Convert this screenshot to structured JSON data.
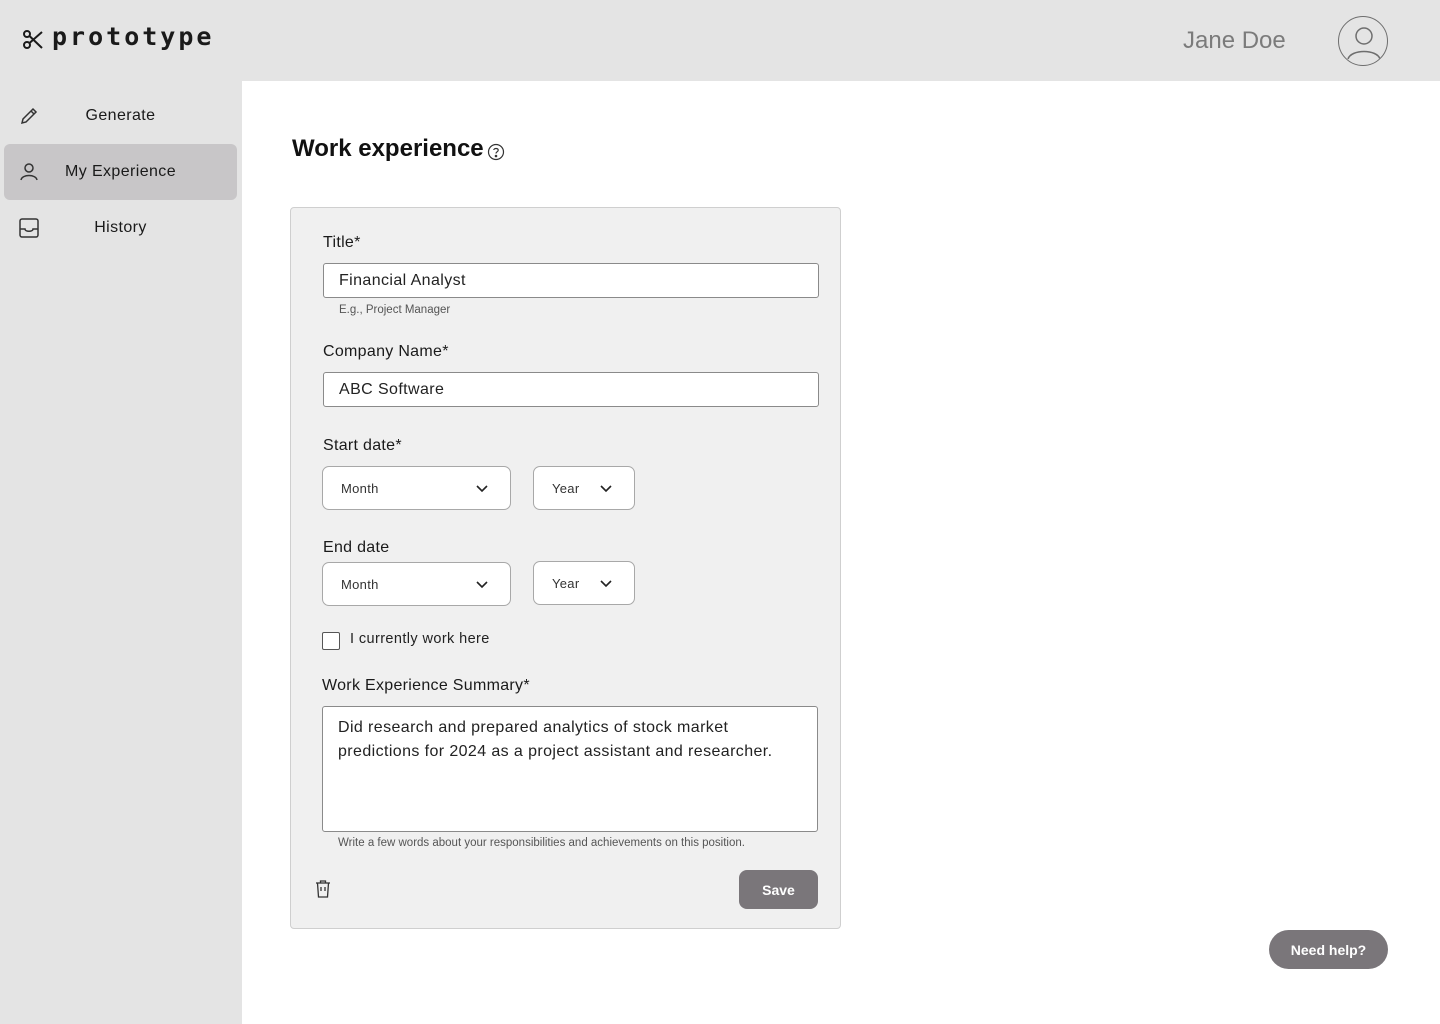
{
  "app": {
    "name": "prototype"
  },
  "header": {
    "user_name": "Jane Doe"
  },
  "sidebar": {
    "items": [
      {
        "label": "Generate",
        "icon": "pencil-icon",
        "active": false
      },
      {
        "label": "My Experience",
        "icon": "person-icon",
        "active": true
      },
      {
        "label": "History",
        "icon": "inbox-icon",
        "active": false
      }
    ]
  },
  "main": {
    "title": "Work experience",
    "form": {
      "title_label": "Title*",
      "title_value": "Financial Analyst",
      "title_hint": "E.g., Project Manager",
      "company_label": "Company Name*",
      "company_value": "ABC Software",
      "start_label": "Start date*",
      "start_month": "Month",
      "start_year": "Year",
      "end_label": "End date",
      "end_month": "Month",
      "end_year": "Year",
      "current_label": "I currently work here",
      "current_checked": false,
      "summary_label": "Work Experience Summary*",
      "summary_value": "Did research and prepared analytics of stock market predictions for 2024 as a project assistant and researcher.",
      "summary_hint": "Write a few words about your responsibilities and achievements on this position.",
      "save_label": "Save"
    },
    "help_button": "Need help?"
  },
  "colors": {
    "button_bg": "#7a767a",
    "active_nav_bg": "#c8c6c8",
    "sidebar_bg": "#e4e4e4"
  }
}
